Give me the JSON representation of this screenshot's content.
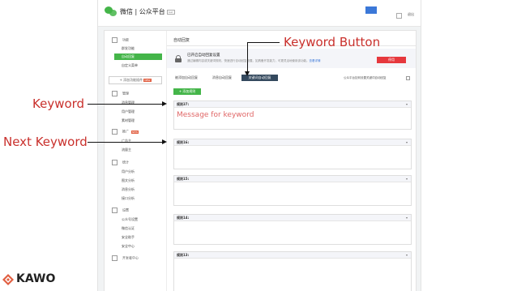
{
  "app": {
    "brand": "微信 | 公众平台",
    "brand_tag": "test",
    "user_name": "",
    "logout_label": "退出"
  },
  "sidebar": {
    "sections": [
      {
        "key": "function",
        "label": "功能",
        "icon": "grid-icon"
      },
      {
        "key": "manage",
        "label": "管理",
        "icon": "message-icon"
      },
      {
        "key": "promo",
        "label": "推广",
        "icon": "megaphone-icon",
        "badge": "NEW"
      },
      {
        "key": "stats",
        "label": "统计",
        "icon": "stats-icon"
      },
      {
        "key": "settings",
        "label": "设置",
        "icon": "gear-icon"
      },
      {
        "key": "developer",
        "label": "开发者中心",
        "icon": "person-icon"
      }
    ],
    "items": [
      {
        "label": "群发功能",
        "section": "function",
        "active": false
      },
      {
        "label": "自动回复",
        "section": "function",
        "active": true
      },
      {
        "label": "自定义菜单",
        "section": "function",
        "active": false
      },
      {
        "label": "消息管理",
        "section": "manage",
        "active": false
      },
      {
        "label": "用户管理",
        "section": "manage",
        "active": false
      },
      {
        "label": "素材管理",
        "section": "manage",
        "active": false
      },
      {
        "label": "广告主",
        "section": "promo",
        "active": false
      },
      {
        "label": "流量主",
        "section": "promo",
        "active": false
      },
      {
        "label": "用户分析",
        "section": "stats",
        "active": false
      },
      {
        "label": "图文分析",
        "section": "stats",
        "active": false
      },
      {
        "label": "消息分析",
        "section": "stats",
        "active": false
      },
      {
        "label": "接口分析",
        "section": "stats",
        "active": false
      },
      {
        "label": "公众号设置",
        "section": "settings",
        "active": false
      },
      {
        "label": "微信认证",
        "section": "settings",
        "active": false
      },
      {
        "label": "安全助手",
        "section": "settings",
        "active": false
      },
      {
        "label": "安全中心",
        "section": "settings",
        "active": false
      }
    ],
    "add_plugin_label": "+ 添加功能插件",
    "add_plugin_badge": "NEW"
  },
  "main": {
    "title": "自动回复",
    "notice": {
      "title": "已开启自动回复设置",
      "desc": "通过编辑内容或关键词规则，快速进行自动回复设置。如具备开发能力，可更灵活地使用该功能。",
      "link": "查看详情",
      "disable_label": "停用"
    },
    "tabs": [
      {
        "label": "被添加自动回复",
        "selected": false
      },
      {
        "label": "消息自动回复",
        "selected": false
      },
      {
        "label": "关键词自动回复",
        "selected": true
      }
    ],
    "setting_label": "公众平台如何设置关键词自动回复",
    "add_rule_label": "+ 添加规则",
    "rules": [
      {
        "title": "规则37:",
        "message": "Message for keyword"
      },
      {
        "title": "规则16:",
        "message": ""
      },
      {
        "title": "规则15:",
        "message": ""
      },
      {
        "title": "规则14:",
        "message": ""
      },
      {
        "title": "规则13:",
        "message": ""
      }
    ]
  },
  "annotations": {
    "keyword_button": "Keyword Button",
    "keyword": "Keyword",
    "next_keyword": "Next Keyword"
  },
  "watermark": {
    "text": "KAWO"
  },
  "colors": {
    "wechat_green": "#44b549",
    "danger_red": "#e6383d",
    "selected_tab": "#34495e",
    "annotation_red": "#c9302c",
    "placeholder_red": "#e06666"
  }
}
